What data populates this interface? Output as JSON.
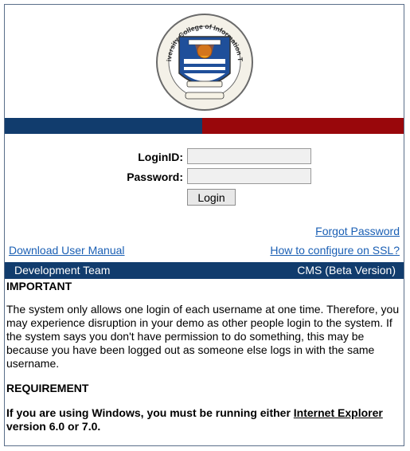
{
  "header": {
    "logo_text": "Punjab University College of Information Technology",
    "colors": {
      "left_bar": "#113c6d",
      "right_bar": "#99070b"
    }
  },
  "login": {
    "loginid_label": "LoginID:",
    "password_label": "Password:",
    "loginid_value": "",
    "password_value": "",
    "button_label": "Login"
  },
  "links": {
    "forgot_password": "Forgot Password",
    "download_manual": "Download User Manual",
    "configure_ssl": "How to configure on SSL?"
  },
  "footer_bar": {
    "left": "Development Team",
    "right": "CMS (Beta Version)"
  },
  "notice": {
    "important_heading": "IMPORTANT",
    "important_text": "The system only allows one login of each username at one time. Therefore, you may experience disruption in your demo as other people login to the system. If the system says you don't have permission to do something, this may be because you have been logged out as someone else logs in with the same username.",
    "requirement_heading": "REQUIREMENT",
    "requirement_pre": "If you are using Windows, you must be running either ",
    "requirement_link": "Internet Explorer",
    "requirement_post": " version 6.0 or 7.0."
  }
}
